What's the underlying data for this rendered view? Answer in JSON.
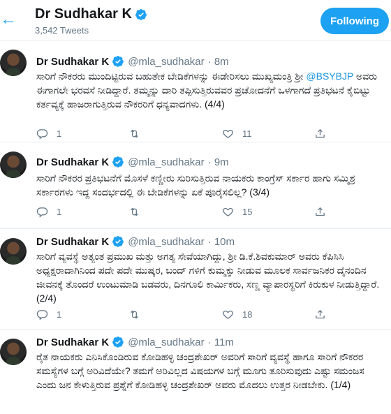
{
  "header": {
    "name": "Dr Sudhakar K",
    "tweet_count": "3,542 Tweets",
    "follow_label": "Following"
  },
  "colors": {
    "accent": "#1da1f2",
    "muted": "#657786",
    "text": "#14171a",
    "border": "#e6ecf0"
  },
  "tweets": [
    {
      "name": "Dr Sudhakar K",
      "handle": "@mla_sudhakar",
      "time": "· 8m",
      "text_before": "ಸಾರಿಗೆ ನೌಕರರು ಮುಂದಿಟ್ಟಿರುವ ಬಹುತೇಕ ಬೇಡಿಕೆಗಳನ್ನು ಈಡೇರಿಸಲು ಮುಖ್ಯಮಂತ್ರಿ ಶ್ರೀ",
      "mention": "@BSYBJP",
      "text_after": " ಅವರು ಈಗಾಗಲೇ ಭರವಸೆ ನೀಡಿದ್ದಾರೆ. ತಮ್ಮನ್ನು ದಾರಿ ತಪ್ಪಿಸುತ್ತಿರುವವರ ಪ್ರಚೋದನೆಗೆ ಒಳಗಾಗದೆ ಪ್ರತಿಭಟನೆ ಕೈಬಿಟ್ಟು ಕರ್ತವ್ಯಕ್ಕೆ ಹಾಜರಾಗುತ್ತಿರುವ ನೌಕರರಿಗೆ ಧನ್ಯವಾದಗಳು. (4/4)",
      "replies": "1",
      "retweets": "",
      "likes": "11"
    },
    {
      "name": "Dr Sudhakar K",
      "handle": "@mla_sudhakar",
      "time": "· 9m",
      "text_before": "ಸಾರಿಗೆ ನೌಕರರ ಪ್ರತಿಭಟನೆಗೆ ಮೊಸಳೆ ಕಣ್ಣೀರು ಸುರಿಸುತ್ತಿರುವ  ನಾಯಕರು ಕಾಂಗ್ರೆಸ್ ಸರ್ಕಾರ ಹಾಗು ಸಮ್ಮಿಶ್ರ ಸರ್ಕಾರಗಳು ಇದ್ದ ಸಂದರ್ಭದಲ್ಲಿ ಈ ಬೇಡಿಕೆಗಳನ್ನು ಏಕೆ ಪೂರೈಸಲಿಲ್ಲ? (3/4)",
      "mention": "",
      "text_after": "",
      "replies": "1",
      "retweets": "",
      "likes": "15"
    },
    {
      "name": "Dr Sudhakar K",
      "handle": "@mla_sudhakar",
      "time": "· 10m",
      "text_before": "ಸಾರಿಗೆ ವ್ಯವಸ್ಥೆ ಅತ್ಯಂತ ಪ್ರಮುಖ ಮತ್ತು ಅಗತ್ಯ ಸೇವೆಯಾಗಿದ್ದು, ಶ್ರೀ ಡಿ.ಕೆ.ಶಿವಕುಮಾರ್ ಅವರು ಕೆಪಿಸಿಸಿ ಅಧ್ಯಕ್ಷರಾದಾಗಿನಿಂದ ಪದೇ ಪದೇ ಮುಷ್ಕರ, ಬಂದ್ ಗಳಿಗೆ ಕುಮ್ಮಕ್ಕು ನೀಡುವ ಮೂಲಕ ಸಾರ್ವಜನಿಕರ ದೈನಂದಿನ ಜೀವನಕ್ಕೆ ತೊಂದರೆ ಉಂಟುಮಾಡಿ ಬಡವರು, ದಿನಗೂಲಿ ಕಾರ್ಮಿಕರು, ಸಣ್ಣ ವ್ಯಾಪಾರಸ್ಥರಿಗೆ ಕಿರುಕುಳ ನೀಡುತ್ತಿದ್ದಾರೆ. (2/4)",
      "mention": "",
      "text_after": "",
      "replies": "1",
      "retweets": "",
      "likes": "18"
    },
    {
      "name": "Dr Sudhakar K",
      "handle": "@mla_sudhakar",
      "time": "· 11m",
      "text_before": "ರೈತ ನಾಯಕರು ಎನಿಸಿಕೊಂಡಿರುವ ಕೋಡಿಹಳ್ಳಿ ಚಂದ್ರಶೇಖರ್ ಅವರಿಗೆ ಸಾರಿಗೆ ವ್ಯವಸ್ಥೆ ಹಾಗೂ ಸಾರಿಗೆ ನೌಕರರ ಸಮಸ್ಯೆಗಳ ಬಗ್ಗೆ ಅರಿವಿದೆಯೇ? ತಮಗೆ ಅರಿವಿಲ್ಲದ ವಿಷಯಗಳ ಬಗ್ಗೆ ಮೂಗು ತೂರಿಸುವುದು ಎಷ್ಟು ಸಮಂಜಸ ಎಂದು ಜನ ಕೇಳುತ್ತಿರುವ ಪ್ರಶ್ನೆಗೆ ಕೋಡಿಹಳ್ಳಿ ಚಂದ್ರಶೇಖರ್ ಅವರು ಮೊದಲು ಉತ್ತರ ನೀಡಬೇಕು. (1/4)",
      "mention": "",
      "text_after": "",
      "replies": "",
      "retweets": "",
      "likes": ""
    }
  ]
}
